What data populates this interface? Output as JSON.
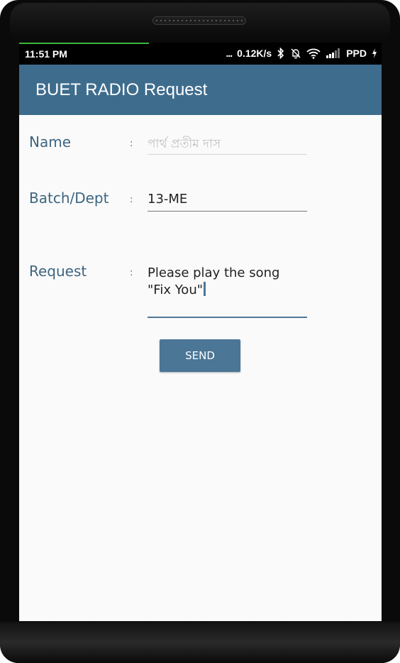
{
  "status_bar": {
    "time": "11:51 PM",
    "dots": "...",
    "net_speed": "0.12K/s",
    "carrier": "PPD",
    "icons": [
      "bluetooth-icon",
      "alarm-off-icon",
      "wifi-icon",
      "signal-icon",
      "charging-icon"
    ]
  },
  "app_bar": {
    "title": "BUET RADIO Request",
    "color": "#3e6c8d"
  },
  "form": {
    "separator": ":",
    "name": {
      "label": "Name",
      "value": "",
      "placeholder": "পার্থ প্রতীম দাস"
    },
    "batch": {
      "label": "Batch/Dept",
      "value": "13-ME"
    },
    "request": {
      "label": "Request",
      "value_line1": "Please play the song",
      "value_line2": "\"Fix You\""
    },
    "send_label": "SEND",
    "button_color": "#4b7696"
  }
}
